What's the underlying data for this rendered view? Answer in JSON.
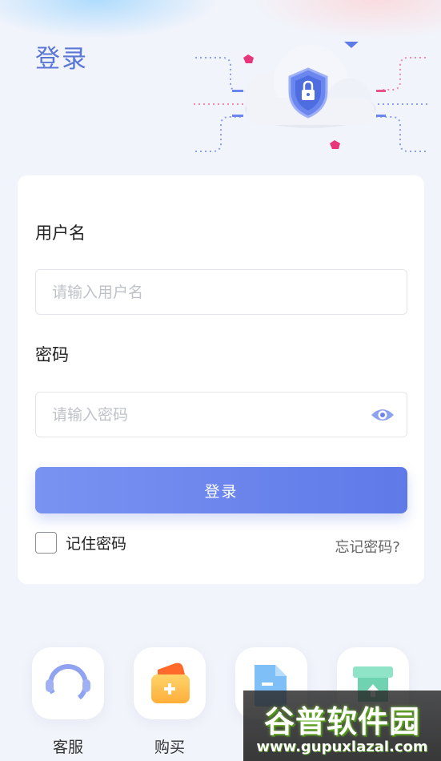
{
  "page": {
    "title": "登录"
  },
  "form": {
    "username_label": "用户名",
    "username_placeholder": "请输入用户名",
    "password_label": "密码",
    "password_placeholder": "请输入密码",
    "login_button": "登录",
    "remember_label": "记住密码",
    "forgot_label": "忘记密码?"
  },
  "shortcuts": [
    {
      "label": "客服",
      "icon": "headset-icon"
    },
    {
      "label": "购买",
      "icon": "wallet-plus-icon"
    },
    {
      "label": "",
      "icon": "document-icon"
    },
    {
      "label": "",
      "icon": "upload-icon"
    }
  ],
  "watermark": {
    "logo": "谷普软件园",
    "url": "www.gupuxlazal.com"
  },
  "colors": {
    "accent": "#5b77d6",
    "button": "#6a85ee",
    "background": "#f2f4fb"
  }
}
